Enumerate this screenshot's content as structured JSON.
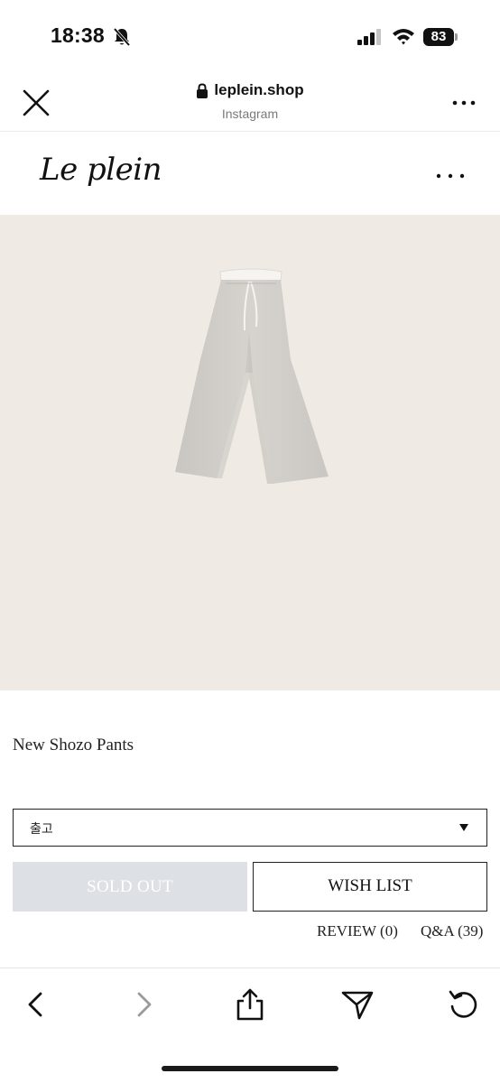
{
  "status_bar": {
    "time": "18:38",
    "battery": "83",
    "icons": [
      "bell-slash-icon",
      "signal-icon",
      "wifi-icon",
      "battery-icon"
    ]
  },
  "browser": {
    "url": "leplein.shop",
    "source": "Instagram",
    "icons": [
      "close-icon",
      "lock-icon",
      "more-icon"
    ]
  },
  "site": {
    "logo": "Le plein",
    "menu_icon": "more-icon"
  },
  "product": {
    "image_icon": "wide-pants-image",
    "image_bg": "#efebe4",
    "name": "New Shozo Pants",
    "option_value": "출고",
    "sold_out_label": "SOLD OUT",
    "wish_list_label": "WISH LIST",
    "review_label": "REVIEW (0)",
    "qa_label": "Q&A (39)"
  },
  "toolbar": {
    "icons": [
      "back-icon",
      "forward-icon",
      "share-icon",
      "send-icon",
      "reload-icon"
    ]
  }
}
